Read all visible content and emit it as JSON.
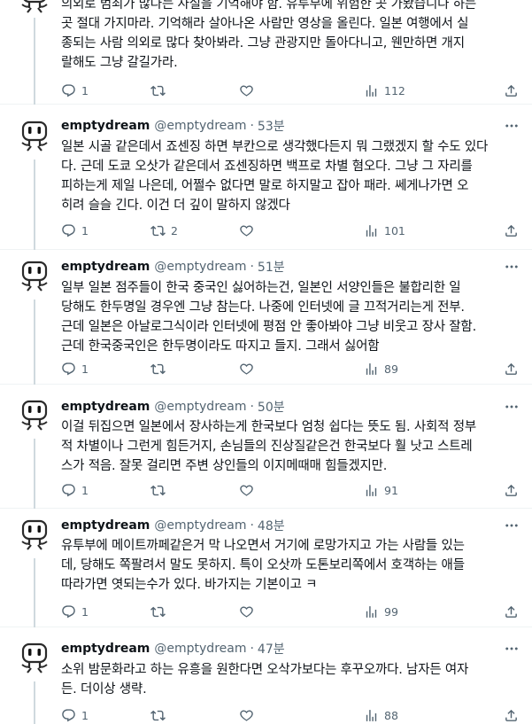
{
  "top_tweet": {
    "lines": [
      "의외로 범죄가 많다는 사실을 기억해야 함. 유투부에 위험한 곳 가봤습니다 하는",
      "곳 절대 가지마라. 기억해라 살아나온 사람만 영상을 올린다. 일본 여행에서 실",
      "종되는 사람 의외로 많다 찾아봐라. 그냥 관광지만 돌아다니고, 웬만하면 개지",
      "랄해도 그냥 갈길가라."
    ],
    "replies": "1",
    "retweets": "",
    "likes": "",
    "views": "112"
  },
  "tweets": [
    {
      "name": "emptydream",
      "handle": "@emptydream",
      "time": "53분",
      "lines": [
        "일본 시골 같은데서 죠센징 하면 부칸으로 생각했다든지 뭐 그랬겠지 할 수도 있다",
        "다. 근데 도쿄 오삿가 같은데서 죠센징하면 백프로 차별 혐오다. 그냥 그 자리를",
        "피하는게 제일 나은데, 어쩔수 없다면 말로 하지말고 잡아 패라. 쎄게나가면 오",
        "히려 슬슬 긴다. 이건 더 깊이 말하지 않겠다"
      ],
      "replies": "1",
      "retweets": "2",
      "likes": "",
      "views": "101"
    },
    {
      "name": "emptydream",
      "handle": "@emptydream",
      "time": "51분",
      "lines": [
        "일부 일본 점주들이 한국 중국인 싫어하는건, 일본인 서양인들은 불합리한 일",
        "당해도 한두명일 경우엔 그냥 참는다. 나중에 인터넷에 글 끄적거리는게 전부.",
        "근데 일본은 아날로그식이라 인터넷에 평점 안 좋아봐야 그냥 비웃고 장사 잘함.",
        "근데 한국중국인은 한두명이라도 따지고 들지. 그래서 싫어함"
      ],
      "replies": "1",
      "retweets": "",
      "likes": "",
      "views": "89"
    },
    {
      "name": "emptydream",
      "handle": "@emptydream",
      "time": "50분",
      "lines": [
        "이걸 뒤집으면 일본에서 장사하는게 한국보다 엄청 쉽다는 뜻도 됨. 사회적 정부",
        "적 차별이나 그런게 힘든거지, 손님들의 진상질같은건 한국보다 훨 낫고 스트레",
        "스가 적음. 잘못 걸리면 주변 상인들의 이지메때매 힘들겠지만."
      ],
      "replies": "1",
      "retweets": "",
      "likes": "",
      "views": "91"
    },
    {
      "name": "emptydream",
      "handle": "@emptydream",
      "time": "48분",
      "lines": [
        "유투부에 메이트까페같은거 막 나오면서 거기에 로망가지고 가는 사람들 있는",
        "데, 당해도 쪽팔려서 말도 못하지. 특이 오삿까 도톤보리쪽에서 호객하는 애들",
        "따라가면 엿되는수가 있다. 바가지는 기본이고 ㅋ"
      ],
      "replies": "1",
      "retweets": "",
      "likes": "",
      "views": "99"
    },
    {
      "name": "emptydream",
      "handle": "@emptydream",
      "time": "47분",
      "lines": [
        "소위 밤문화라고 하는 유흥을 원한다면 오삭가보다는 후꾸오까다. 남자든 여자",
        "든. 더이상 생략."
      ],
      "replies": "1",
      "retweets": "",
      "likes": "",
      "views": "88"
    }
  ],
  "icons": {
    "reply": "reply-icon",
    "retweet": "retweet-icon",
    "like": "heart-icon",
    "views": "views-chart-icon",
    "share": "share-icon",
    "more": "more-dots-icon"
  },
  "colors": {
    "text": "#0f1419",
    "secondary": "#536471",
    "divider": "#eff3f4",
    "thread_line": "#cfd9de"
  }
}
